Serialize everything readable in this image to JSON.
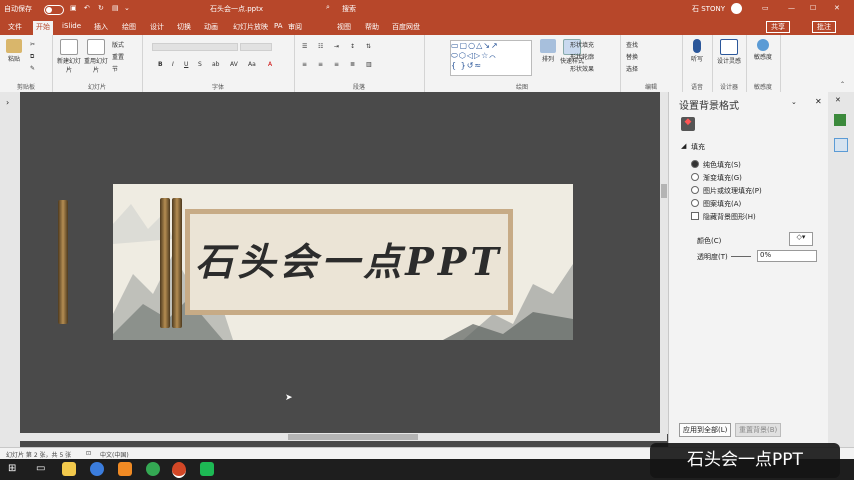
{
  "titlebar": {
    "autosave_label": "自动保存",
    "file_name": "石头会一点.pptx",
    "search_placeholder": "搜索",
    "user_name": "石 STONY",
    "bg_color": "#b7472a"
  },
  "tabs": [
    "文件",
    "开始",
    "iSlide",
    "插入",
    "绘图",
    "设计",
    "切换",
    "动画",
    "幻灯片放映",
    "PA",
    "审阅",
    "视图",
    "帮助",
    "百度网盘"
  ],
  "active_tab": "开始",
  "share_label": "共享",
  "comments_label": "批注",
  "ribbon": {
    "groups": [
      "剪贴板",
      "幻灯片",
      "字体",
      "段落",
      "绘图",
      "编辑",
      "语音",
      "设计器",
      "敏感度"
    ],
    "paste": "粘贴",
    "new_slide": "新建幻灯片",
    "reuse_slide": "重用幻灯片",
    "find": "查找",
    "replace": "替换",
    "select": "选择",
    "dictate": "听写",
    "designer": "设计灵感",
    "sensitivity": "敏感度",
    "layout": "版式",
    "reset": "重置",
    "section": "节",
    "fill": "形状填充",
    "outline": "形状轮廓",
    "effects": "形状效果",
    "arrange": "排列",
    "quick_styles": "快速样式"
  },
  "slide": {
    "title_text": "石头会一点PPT",
    "accent": "#c7ab86"
  },
  "pane": {
    "title": "设置背景格式",
    "section": "填充",
    "options": [
      "纯色填充(S)",
      "渐变填充(G)",
      "图片或纹理填充(P)",
      "图案填充(A)",
      "隐藏背景图形(H)"
    ],
    "color_label": "颜色(C)",
    "transparency_label": "透明度(T)",
    "transparency_value": "0%",
    "apply_all": "应用到全部(L)",
    "reset_bg": "重置背景(B)"
  },
  "status": {
    "slide_info": "幻灯片 第 2 张，共 5 张",
    "language": "中文(中国)"
  },
  "caption": "石头会一点PPT"
}
